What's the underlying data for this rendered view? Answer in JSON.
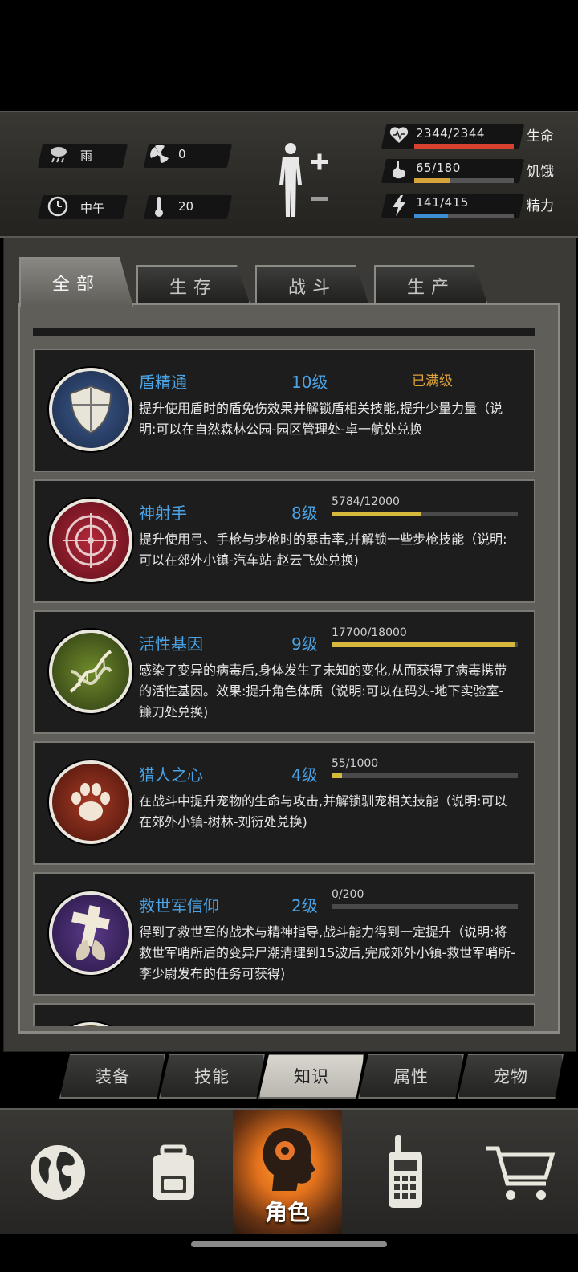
{
  "status": {
    "weather": "雨",
    "radiation": "0",
    "time": "中午",
    "temperature": "20",
    "vitals": [
      {
        "value": "2344/2344",
        "label": "生命",
        "fraction": 1.0,
        "color": "#d8402f",
        "icon": "heart-icon"
      },
      {
        "value": "65/180",
        "label": "饥饿",
        "fraction": 0.36,
        "color": "#d6a43a",
        "icon": "stomach-icon"
      },
      {
        "value": "141/415",
        "label": "精力",
        "fraction": 0.34,
        "color": "#3e8ed4",
        "icon": "energy-icon"
      }
    ]
  },
  "tabs": [
    "全部",
    "生存",
    "战斗",
    "生产"
  ],
  "skills": [
    {
      "name": "盾精通",
      "level": "10级",
      "status": "已满级",
      "icon": "shield-icon",
      "desc": "提升使用盾时的盾免伤效果并解锁盾相关技能,提升少量力量（说明:可以在自然森林公园-园区管理处-卓一航处兑换"
    },
    {
      "name": "神射手",
      "level": "8级",
      "progress": "5784/12000",
      "fraction": 0.482,
      "icon": "crosshair-icon",
      "desc": "提升使用弓、手枪与步枪时的暴击率,并解锁一些步枪技能（说明:可以在郊外小镇-汽车站-赵云飞处兑换)"
    },
    {
      "name": "活性基因",
      "level": "9级",
      "progress": "17700/18000",
      "fraction": 0.983,
      "icon": "dna-icon",
      "desc": "感染了变异的病毒后,身体发生了未知的变化,从而获得了病毒携带的活性基因。效果:提升角色体质（说明:可以在码头-地下实验室-镰刀处兑换)"
    },
    {
      "name": "猎人之心",
      "level": "4级",
      "progress": "55/1000",
      "fraction": 0.055,
      "icon": "paw-icon",
      "desc": "在战斗中提升宠物的生命与攻击,并解锁驯宠相关技能（说明:可以在郊外小镇-树林-刘衍处兑换)"
    },
    {
      "name": "救世军信仰",
      "level": "2级",
      "progress": "0/200",
      "fraction": 0.0,
      "icon": "cross-icon",
      "desc": "得到了救世军的战术与精神指导,战斗能力得到一定提升（说明:将救世军哨所后的变异尸潮清理到15波后,完成郊外小镇-救世军哨所-李少尉发布的任务可获得)"
    }
  ],
  "subnav": [
    "装备",
    "技能",
    "知识",
    "属性",
    "宠物"
  ],
  "bottomnav": {
    "active_label": "角色"
  }
}
